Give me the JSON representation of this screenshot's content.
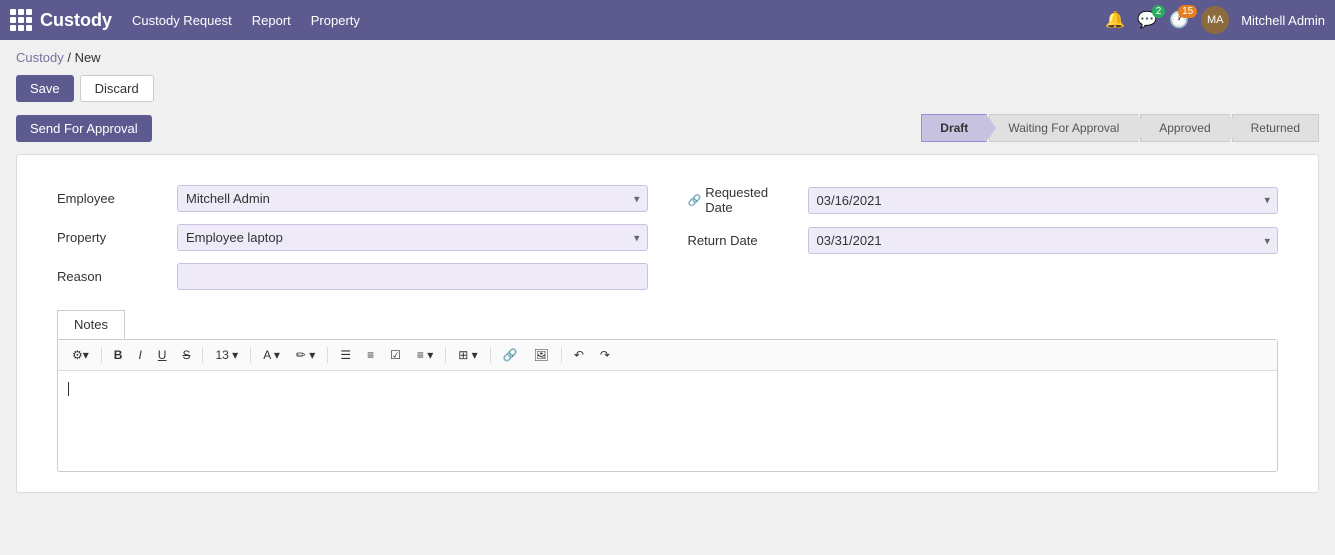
{
  "app": {
    "logo_label": "Custody",
    "nav_items": [
      "Custody Request",
      "Report",
      "Property"
    ],
    "notifications_badge": "",
    "messages_badge": "2",
    "updates_badge": "15",
    "admin_name": "Mitchell Admin"
  },
  "breadcrumb": {
    "parent": "Custody",
    "separator": "/",
    "current": "New"
  },
  "toolbar": {
    "save_label": "Save",
    "discard_label": "Discard",
    "send_approval_label": "Send For Approval"
  },
  "status_steps": [
    {
      "label": "Draft",
      "active": true
    },
    {
      "label": "Waiting For Approval",
      "active": false
    },
    {
      "label": "Approved",
      "active": false
    },
    {
      "label": "Returned",
      "active": false
    }
  ],
  "form": {
    "employee_label": "Employee",
    "employee_value": "Mitchell Admin",
    "property_label": "Property",
    "property_value": "Employee laptop",
    "reason_label": "Reason",
    "reason_value": "",
    "requested_date_label": "Requested Date",
    "requested_date_value": "03/16/2021",
    "return_date_label": "Return Date",
    "return_date_value": "03/31/2021"
  },
  "notes": {
    "tab_label": "Notes"
  },
  "editor_toolbar": {
    "cog": "⚙",
    "bold": "B",
    "italic": "I",
    "underline": "U",
    "strikethrough": "S̶",
    "font_size": "13 ▾",
    "font_color": "A ▾",
    "pen": "✏ ▾",
    "unordered_list": "☰",
    "ordered_list": "≡",
    "checkbox": "☑",
    "align": "≡ ▾",
    "table": "⊞ ▾",
    "link": "🔗",
    "image": "🖼",
    "undo": "↶",
    "redo": "↷"
  }
}
